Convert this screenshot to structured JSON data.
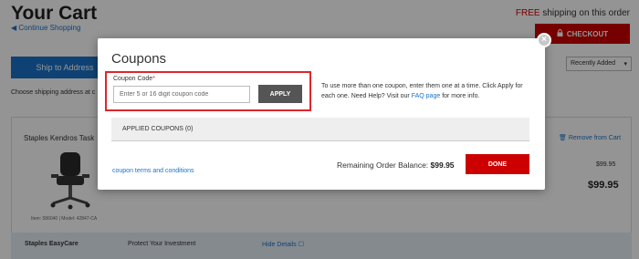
{
  "background": {
    "cart_title": "Your Cart",
    "continue_link": "Continue Shopping",
    "free_shipping_prefix": "FREE",
    "free_shipping_suffix": " shipping on this order",
    "checkout_label": "CHECKOUT",
    "ship_tab_label": "Ship to Address",
    "ship_text": "Choose shipping address at c",
    "sort_value": "Recently Added",
    "item_name": "Staples Kendros Task",
    "item_meta": "Item: 586040 | Model: 42847-CA",
    "remove_label": "Remove from Cart",
    "price_small": "$99.95",
    "price_big": "$99.95",
    "easycare_title": "Staples EasyCare",
    "easycare_protect": "Protect Your Investment",
    "easycare_hide": "Hide Details"
  },
  "modal": {
    "title": "Coupons",
    "coupon_label": "Coupon Code",
    "coupon_required_mark": "*",
    "coupon_placeholder": "Enter 5 or 16 digit coupon code",
    "apply_label": "APPLY",
    "help_text_before": "To use more than one coupon, enter them one at a time. Click Apply for each one. Need Help? Visit our ",
    "help_link": "FAQ page",
    "help_text_after": " for more info.",
    "applied_coupons": "APPLIED COUPONS (0)",
    "terms_link": "coupon terms and conditions",
    "balance_label": "Remaining Order Balance: ",
    "balance_value": "$99.95",
    "done_label": "DONE",
    "close_label": "×"
  },
  "colors": {
    "accent_red": "#cc0000",
    "highlight_red": "#e0262b",
    "link_blue": "#1a73c9",
    "apply_gray": "#555555"
  },
  "icons": [
    "arrow-left-icon",
    "lock-icon",
    "chevron-down-icon",
    "trash-icon",
    "external-link-icon",
    "close-icon"
  ]
}
